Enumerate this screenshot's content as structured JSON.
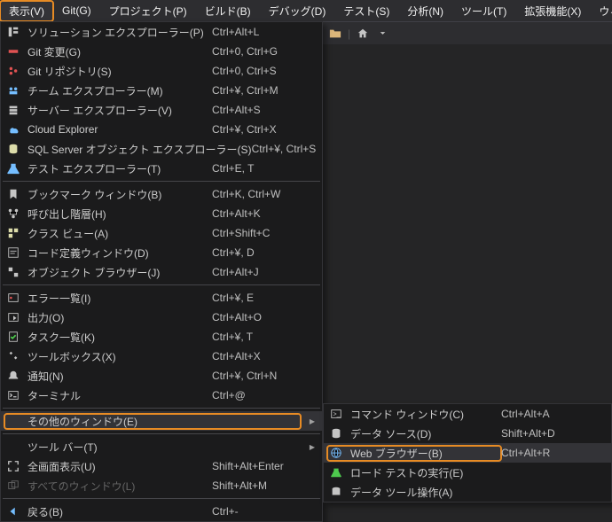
{
  "menubar": {
    "items": [
      {
        "label": "表示(V)",
        "active": true,
        "highlight": true
      },
      {
        "label": "Git(G)"
      },
      {
        "label": "プロジェクト(P)"
      },
      {
        "label": "ビルド(B)"
      },
      {
        "label": "デバッグ(D)"
      },
      {
        "label": "テスト(S)"
      },
      {
        "label": "分析(N)"
      },
      {
        "label": "ツール(T)"
      },
      {
        "label": "拡張機能(X)"
      },
      {
        "label": "ウィンドウ(W)"
      }
    ]
  },
  "dropdown_main": {
    "rows": [
      {
        "icon": "solution-explorer",
        "label": "ソリューション エクスプローラー(P)",
        "shortcut": "Ctrl+Alt+L"
      },
      {
        "icon": "git-changes",
        "label": "Git 変更(G)",
        "shortcut": "Ctrl+0, Ctrl+G"
      },
      {
        "icon": "git-repo",
        "label": "Git リポジトリ(S)",
        "shortcut": "Ctrl+0, Ctrl+S"
      },
      {
        "icon": "team-explorer",
        "label": "チーム エクスプローラー(M)",
        "shortcut": "Ctrl+¥, Ctrl+M"
      },
      {
        "icon": "server-explorer",
        "label": "サーバー エクスプローラー(V)",
        "shortcut": "Ctrl+Alt+S"
      },
      {
        "icon": "cloud-explorer",
        "label": "Cloud Explorer",
        "shortcut": "Ctrl+¥, Ctrl+X"
      },
      {
        "icon": "sql-explorer",
        "label": "SQL Server オブジェクト エクスプローラー(S)",
        "shortcut": "Ctrl+¥, Ctrl+S"
      },
      {
        "icon": "test-explorer",
        "label": "テスト エクスプローラー(T)",
        "shortcut": "Ctrl+E, T"
      },
      {
        "sep": true
      },
      {
        "icon": "bookmark-window",
        "label": "ブックマーク ウィンドウ(B)",
        "shortcut": "Ctrl+K, Ctrl+W"
      },
      {
        "icon": "call-hierarchy",
        "label": "呼び出し階層(H)",
        "shortcut": "Ctrl+Alt+K"
      },
      {
        "icon": "class-view",
        "label": "クラス ビュー(A)",
        "shortcut": "Ctrl+Shift+C"
      },
      {
        "icon": "code-definition",
        "label": "コード定義ウィンドウ(D)",
        "shortcut": "Ctrl+¥, D"
      },
      {
        "icon": "object-browser",
        "label": "オブジェクト ブラウザー(J)",
        "shortcut": "Ctrl+Alt+J"
      },
      {
        "sep": true
      },
      {
        "icon": "error-list",
        "label": "エラー一覧(I)",
        "shortcut": "Ctrl+¥, E"
      },
      {
        "icon": "output",
        "label": "出力(O)",
        "shortcut": "Ctrl+Alt+O"
      },
      {
        "icon": "task-list",
        "label": "タスク一覧(K)",
        "shortcut": "Ctrl+¥, T"
      },
      {
        "icon": "toolbox",
        "label": "ツールボックス(X)",
        "shortcut": "Ctrl+Alt+X"
      },
      {
        "icon": "notifications",
        "label": "通知(N)",
        "shortcut": "Ctrl+¥, Ctrl+N"
      },
      {
        "icon": "terminal",
        "label": "ターミナル",
        "shortcut": "Ctrl+@"
      },
      {
        "sep": true
      },
      {
        "icon": "",
        "label": "その他のウィンドウ(E)",
        "shortcut": "",
        "submenu": true,
        "hover": true,
        "highlight": true
      },
      {
        "sep": true
      },
      {
        "icon": "",
        "label": "ツール バー(T)",
        "shortcut": "",
        "submenu": true
      },
      {
        "icon": "full-screen",
        "label": "全画面表示(U)",
        "shortcut": "Shift+Alt+Enter"
      },
      {
        "icon": "all-windows",
        "label": "すべてのウィンドウ(L)",
        "shortcut": "Shift+Alt+M",
        "disabled": true
      },
      {
        "sep": true
      },
      {
        "icon": "back",
        "label": "戻る(B)",
        "shortcut": "Ctrl+-"
      }
    ]
  },
  "dropdown_sub": {
    "rows": [
      {
        "icon": "command-window",
        "label": "コマンド ウィンドウ(C)",
        "shortcut": "Ctrl+Alt+A"
      },
      {
        "icon": "data-source",
        "label": "データ ソース(D)",
        "shortcut": "Shift+Alt+D"
      },
      {
        "icon": "web-browser",
        "label": "Web ブラウザー(B)",
        "shortcut": "Ctrl+Alt+R",
        "hover": true,
        "highlight": true
      },
      {
        "icon": "load-test",
        "label": "ロード テストの実行(E)",
        "shortcut": ""
      },
      {
        "icon": "data-tools",
        "label": "データ ツール操作(A)",
        "shortcut": ""
      }
    ]
  },
  "toolbar": {
    "icons": [
      "folder-icon",
      "home-icon",
      "chevron-down-icon"
    ]
  }
}
